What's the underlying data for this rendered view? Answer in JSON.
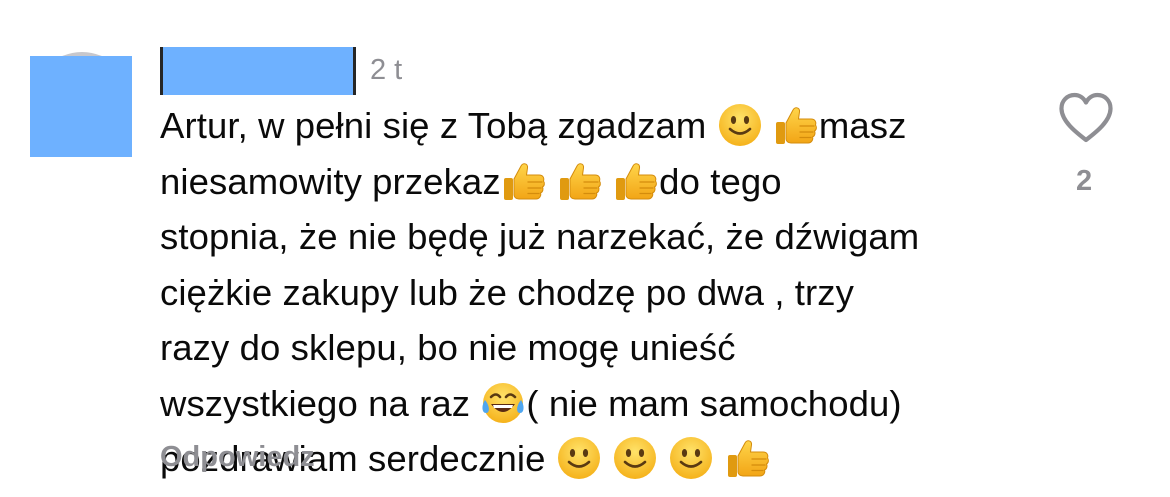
{
  "comment": {
    "author_name": "",
    "time": "2 t",
    "lines": [
      [
        {
          "t": "text",
          "v": "Artur, w pełni się z Tobą zgadzam "
        },
        {
          "t": "emoji",
          "v": "smile-emoji"
        },
        {
          "t": "text",
          "v": " "
        },
        {
          "t": "emoji",
          "v": "thumbs-up-emoji"
        },
        {
          "t": "text",
          "v": "masz"
        }
      ],
      [
        {
          "t": "text",
          "v": "niesamowity przekaz"
        },
        {
          "t": "emoji",
          "v": "thumbs-up-emoji"
        },
        {
          "t": "text",
          "v": " "
        },
        {
          "t": "emoji",
          "v": "thumbs-up-emoji"
        },
        {
          "t": "text",
          "v": " "
        },
        {
          "t": "emoji",
          "v": "thumbs-up-emoji"
        },
        {
          "t": "text",
          "v": "do tego"
        }
      ],
      [
        {
          "t": "text",
          "v": "stopnia, że nie będę już narzekać, że dźwigam"
        }
      ],
      [
        {
          "t": "text",
          "v": "ciężkie zakupy lub że chodzę po dwa , trzy"
        }
      ],
      [
        {
          "t": "text",
          "v": "razy do sklepu, bo nie mogę unieść"
        }
      ],
      [
        {
          "t": "text",
          "v": "wszystkiego na raz "
        },
        {
          "t": "emoji",
          "v": "tears-of-joy-emoji"
        },
        {
          "t": "text",
          "v": "( nie mam samochodu)"
        }
      ],
      [
        {
          "t": "text",
          "v": "pozdrawiam serdecznie "
        },
        {
          "t": "emoji",
          "v": "smile-emoji"
        },
        {
          "t": "text",
          "v": " "
        },
        {
          "t": "emoji",
          "v": "smile-emoji"
        },
        {
          "t": "text",
          "v": " "
        },
        {
          "t": "emoji",
          "v": "smile-emoji"
        },
        {
          "t": "text",
          "v": " "
        },
        {
          "t": "emoji",
          "v": "thumbs-up-emoji"
        }
      ]
    ],
    "reply_label": "Odpowiedz",
    "like_icon": "heart-outline-icon",
    "like_count": "2"
  },
  "colors": {
    "text": "#0a0a0a",
    "secondary_text": "#8e8e93",
    "redaction_mask": "#6eb1ff"
  }
}
